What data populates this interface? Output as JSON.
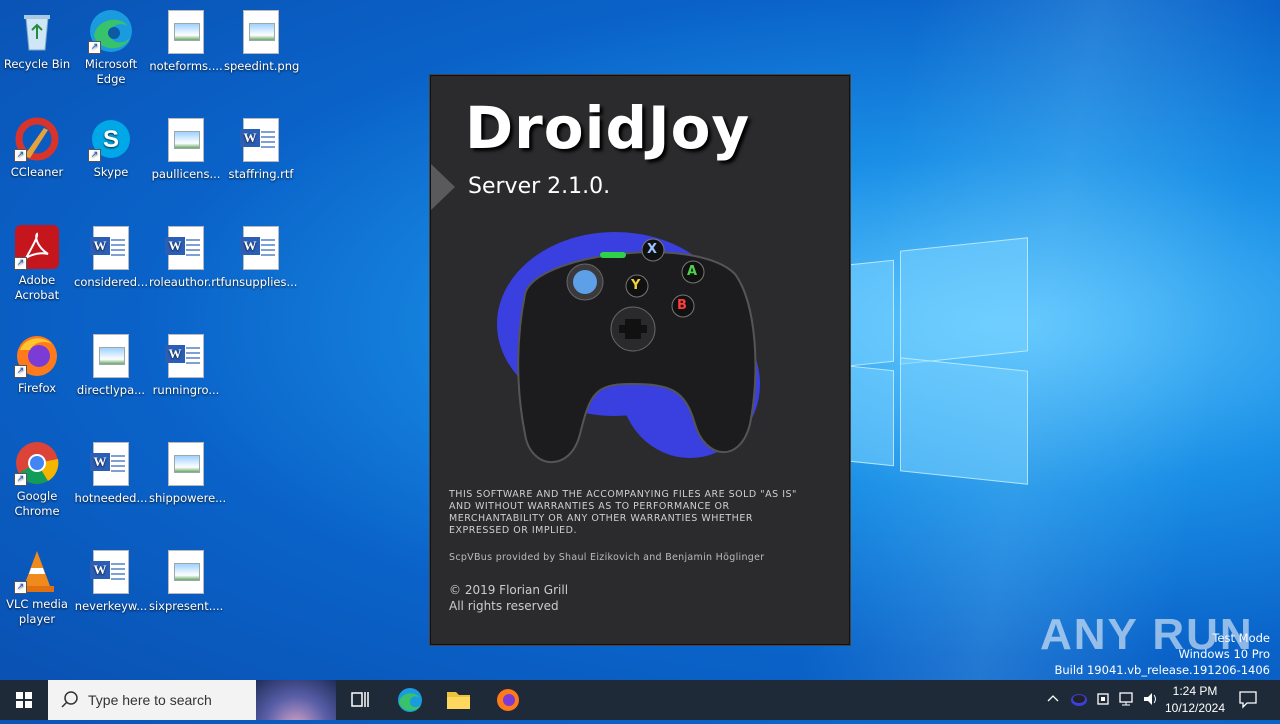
{
  "desktop": {
    "icons": [
      {
        "label": "Recycle Bin"
      },
      {
        "label": "Microsoft Edge"
      },
      {
        "label": "noteforms...."
      },
      {
        "label": "speedint.png"
      },
      {
        "label": "CCleaner"
      },
      {
        "label": "Skype"
      },
      {
        "label": "paullicens..."
      },
      {
        "label": "staffring.rtf"
      },
      {
        "label": "Adobe Acrobat"
      },
      {
        "label": "considered..."
      },
      {
        "label": "roleauthor.rtf"
      },
      {
        "label": "unsupplies..."
      },
      {
        "label": "Firefox"
      },
      {
        "label": "directlypa..."
      },
      {
        "label": "runningro..."
      },
      {
        "label": "Google Chrome"
      },
      {
        "label": "hotneeded..."
      },
      {
        "label": "shippowere..."
      },
      {
        "label": "VLC media player"
      },
      {
        "label": "neverkeyw..."
      },
      {
        "label": "sixpresent...."
      }
    ]
  },
  "splash": {
    "title": "DroidJoy",
    "version": "Server 2.1.0.",
    "disclaimer": "THIS SOFTWARE AND THE ACCOMPANYING FILES ARE SOLD \"AS IS\" AND WITHOUT WARRANTIES AS TO PERFORMANCE OR MERCHANTABILITY OR ANY OTHER WARRANTIES WHETHER EXPRESSED OR IMPLIED.",
    "credits": "ScpVBus provided by Shaul Eizikovich and Benjamin Höglinger",
    "copyright": "© 2019 Florian Grill",
    "rights": "All rights reserved",
    "buttons": [
      "X",
      "A",
      "Y",
      "B"
    ]
  },
  "watermark": {
    "brand": "ANY RUN",
    "line1": "Test Mode",
    "line2": "Windows 10 Pro",
    "line3": "Build 19041.vb_release.191206-1406"
  },
  "taskbar": {
    "search_placeholder": "Type here to search",
    "time": "1:24 PM",
    "date": "10/12/2024"
  }
}
